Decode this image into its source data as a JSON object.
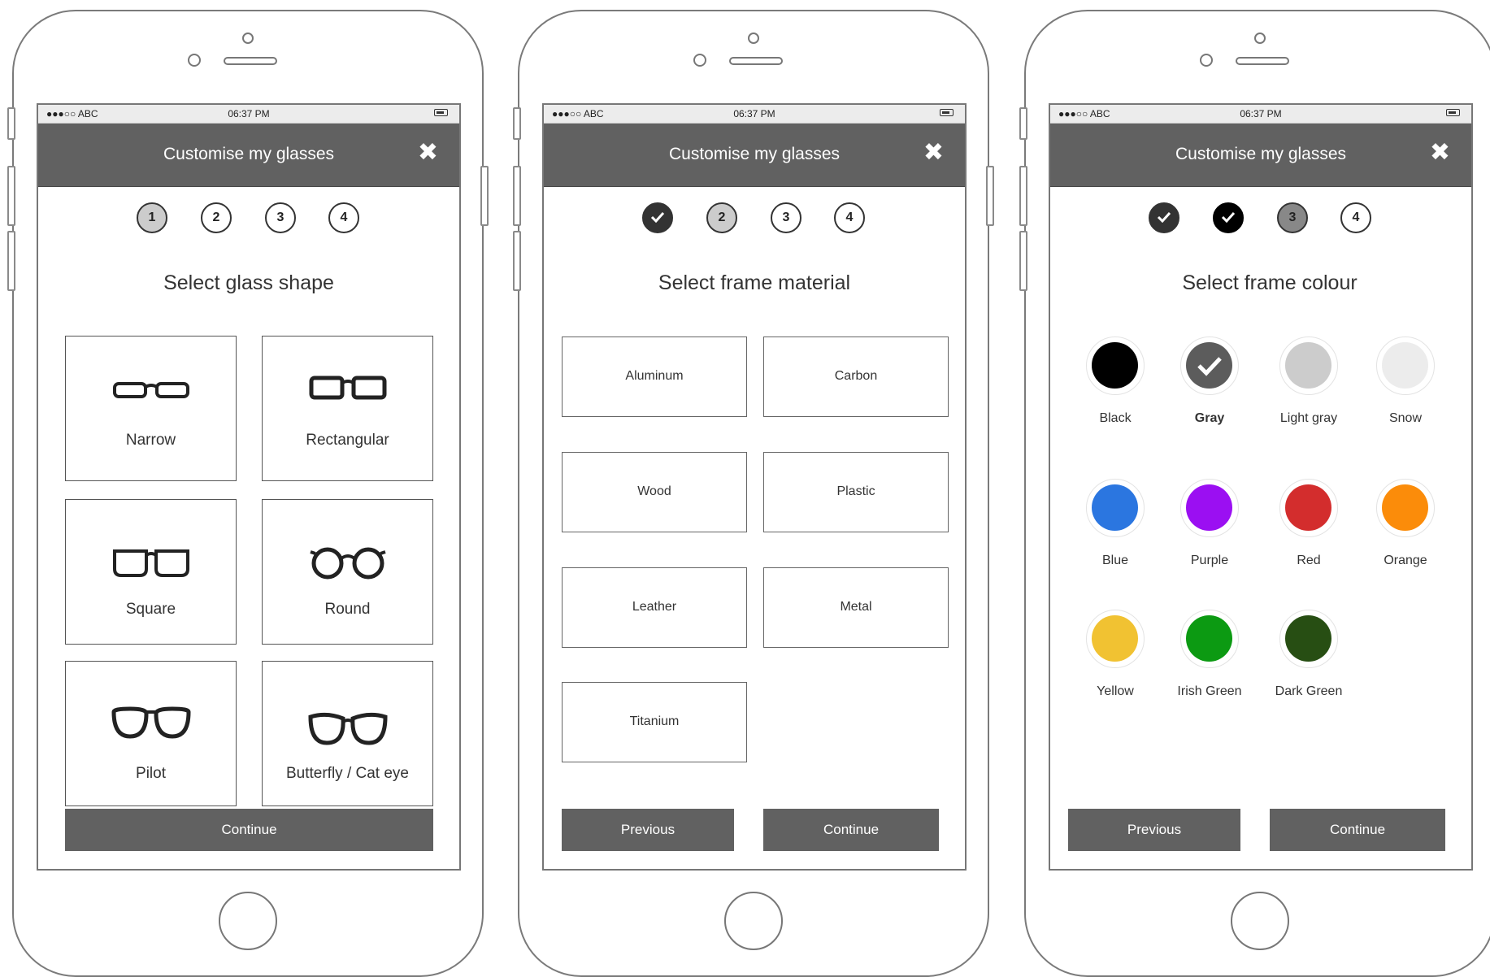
{
  "statusbar": {
    "carrier": "●●●○○ ABC",
    "time": "06:37 PM"
  },
  "header": {
    "title": "Customise my glasses",
    "close_icon": "close-x-icon"
  },
  "screen1": {
    "steps": [
      "1",
      "2",
      "3",
      "4"
    ],
    "heading": "Select glass shape",
    "shapes": [
      "Narrow",
      "Rectangular",
      "Square",
      "Round",
      "Pilot",
      "Butterfly / Cat eye"
    ],
    "continue_label": "Continue"
  },
  "screen2": {
    "steps": [
      "2",
      "3",
      "4"
    ],
    "heading": "Select frame material",
    "materials": [
      "Aluminum",
      "Carbon",
      "Wood",
      "Plastic",
      "Leather",
      "Metal",
      "Titanium"
    ],
    "previous_label": "Previous",
    "continue_label": "Continue"
  },
  "screen3": {
    "steps": [
      "3",
      "4"
    ],
    "heading": "Select frame colour",
    "colours": [
      {
        "label": "Black",
        "hex": "#000000"
      },
      {
        "label": "Gray",
        "hex": "#5c5c5c"
      },
      {
        "label": "Light gray",
        "hex": "#cccccc"
      },
      {
        "label": "Snow",
        "hex": "#ececec"
      },
      {
        "label": "Blue",
        "hex": "#2b76e0"
      },
      {
        "label": "Purple",
        "hex": "#9b0ff2"
      },
      {
        "label": "Red",
        "hex": "#d32d2d"
      },
      {
        "label": "Orange",
        "hex": "#fb8c0a"
      },
      {
        "label": "Yellow",
        "hex": "#f1c232"
      },
      {
        "label": "Irish Green",
        "hex": "#0c9a12"
      },
      {
        "label": "Dark Green",
        "hex": "#274e13"
      }
    ],
    "selected": "Gray",
    "previous_label": "Previous",
    "continue_label": "Continue"
  }
}
